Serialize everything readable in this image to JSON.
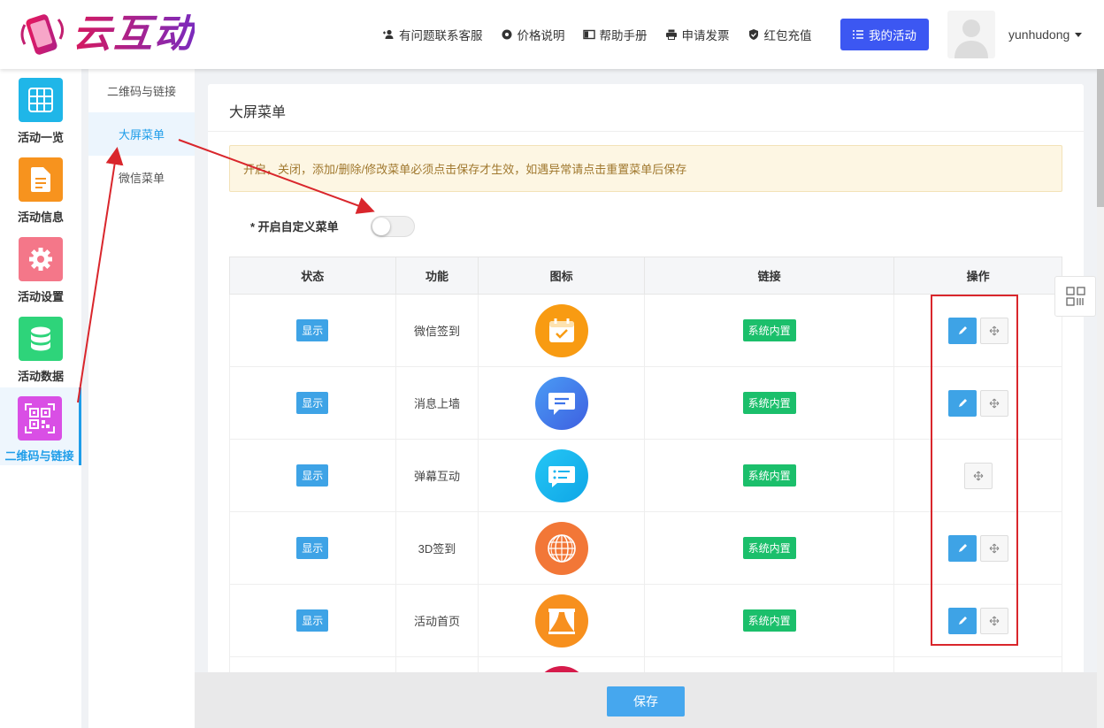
{
  "brand": {
    "name": "云互动"
  },
  "topnav": {
    "items": [
      {
        "label": "有问题联系客服",
        "icon": "user-plus-icon"
      },
      {
        "label": "价格说明",
        "icon": "gear-icon"
      },
      {
        "label": "帮助手册",
        "icon": "book-icon"
      },
      {
        "label": "申请发票",
        "icon": "printer-icon"
      },
      {
        "label": "红包充值",
        "icon": "shield-check-icon"
      }
    ],
    "my_activity": "我的活动",
    "username": "yunhudong"
  },
  "sidebar": {
    "items": [
      {
        "label": "活动一览",
        "icon": "grid-icon",
        "color": "#1fb6e8"
      },
      {
        "label": "活动信息",
        "icon": "document-icon",
        "color": "#f7931e"
      },
      {
        "label": "活动设置",
        "icon": "gear-icon",
        "color": "#f47789"
      },
      {
        "label": "活动数据",
        "icon": "database-icon",
        "color": "#2ed47a"
      },
      {
        "label": "二维码与链接",
        "icon": "qrcode-icon",
        "color": "#d94fe5"
      }
    ]
  },
  "subnav": {
    "items": [
      {
        "label": "二维码与链接"
      },
      {
        "label": "大屏菜单"
      },
      {
        "label": "微信菜单"
      }
    ]
  },
  "main": {
    "title": "大屏菜单",
    "notice": "开启，关闭，添加/删除/修改菜单必须点击保存才生效，如遇异常请点击重置菜单后保存",
    "toggle_label": "* 开启自定义菜单",
    "toggle_on": false,
    "columns": [
      "状态",
      "功能",
      "图标",
      "链接",
      "操作"
    ],
    "rows": [
      {
        "status": "显示",
        "function": "微信签到",
        "icon": "calendar-check-icon",
        "icon_color": "#f89b12",
        "link": "系统内置",
        "editable": true
      },
      {
        "status": "显示",
        "function": "消息上墙",
        "icon": "chat-bubble-icon",
        "icon_color": "#3e74ea",
        "link": "系统内置",
        "editable": true
      },
      {
        "status": "显示",
        "function": "弹幕互动",
        "icon": "danmaku-icon",
        "icon_color": "#19b3ee",
        "link": "系统内置",
        "editable": false
      },
      {
        "status": "显示",
        "function": "3D签到",
        "icon": "globe-icon",
        "icon_color": "#f27737",
        "link": "系统内置",
        "editable": true
      },
      {
        "status": "显示",
        "function": "活动首页",
        "icon": "stage-curtain-icon",
        "icon_color": "#f7901e",
        "link": "系统内置",
        "editable": true
      }
    ],
    "save_label": "保存"
  },
  "colors": {
    "accent": "#1e9de9",
    "primary_button": "#3c57f2",
    "annotation_red": "#d9262c"
  }
}
